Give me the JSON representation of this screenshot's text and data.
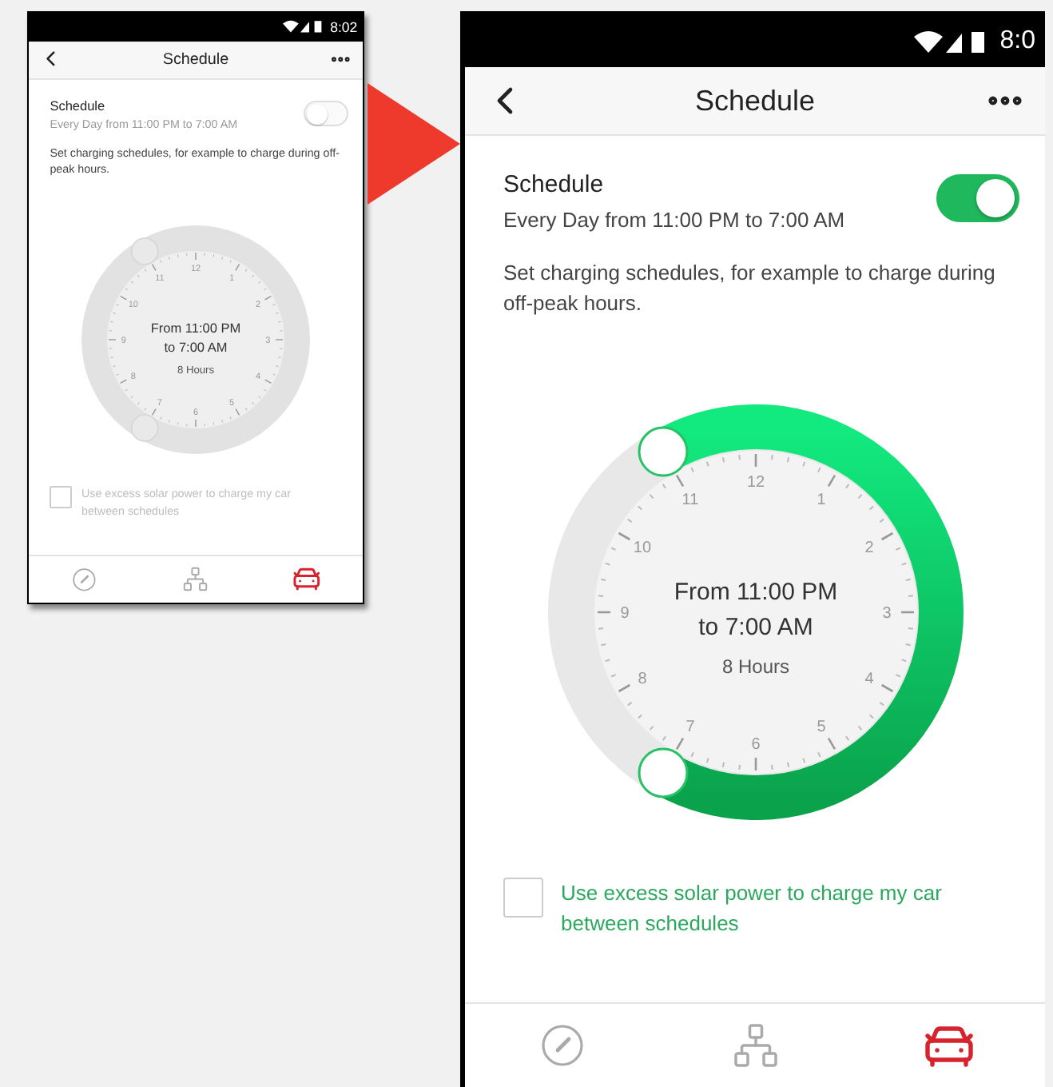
{
  "screens": [
    {
      "status_time": "8:02",
      "title": "Schedule",
      "schedule": {
        "label": "Schedule",
        "summary": "Every Day from 11:00 PM to 7:00 AM",
        "on": false
      },
      "description": "Set charging schedules, for example to charge during off-peak hours.",
      "clock": {
        "from": "From 11:00 PM",
        "to": "to 7:00 AM",
        "duration": "8 Hours",
        "numbers": [
          "12",
          "1",
          "2",
          "3",
          "4",
          "5",
          "6",
          "7",
          "8",
          "9",
          "10",
          "11"
        ]
      },
      "solar": {
        "label": "Use excess solar power to charge my car between schedules",
        "checked": false
      },
      "nav": [
        {
          "kind": "gauge",
          "selected": false
        },
        {
          "kind": "network",
          "selected": false
        },
        {
          "kind": "car",
          "selected": true
        }
      ]
    },
    {
      "status_time": "8:0",
      "title": "Schedule",
      "schedule": {
        "label": "Schedule",
        "summary": "Every Day from 11:00 PM to 7:00 AM",
        "on": true
      },
      "description": "Set charging schedules, for example to charge during off-peak hours.",
      "clock": {
        "from": "From 11:00 PM",
        "to": "to 7:00 AM",
        "duration": "8 Hours",
        "numbers": [
          "12",
          "1",
          "2",
          "3",
          "4",
          "5",
          "6",
          "7",
          "8",
          "9",
          "10",
          "11"
        ]
      },
      "solar": {
        "label": "Use excess solar power to charge my car between schedules",
        "checked": false
      },
      "nav": [
        {
          "kind": "gauge",
          "selected": false
        },
        {
          "kind": "network",
          "selected": false
        },
        {
          "kind": "car",
          "selected": true
        }
      ]
    }
  ]
}
